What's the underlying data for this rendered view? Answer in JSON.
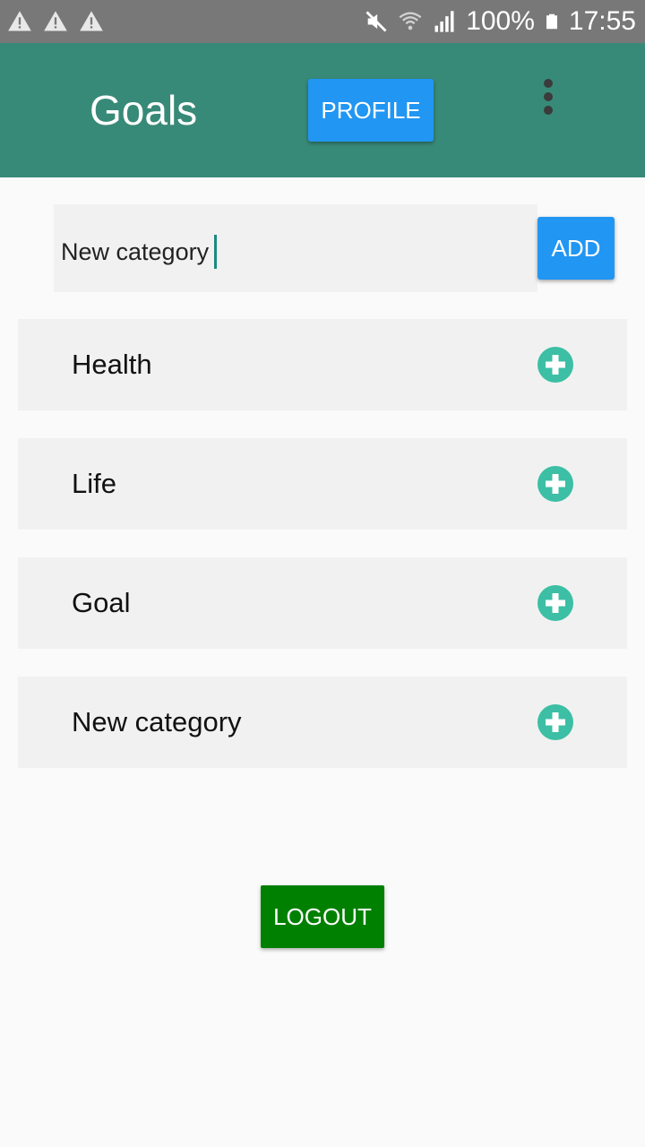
{
  "status_bar": {
    "battery": "100%",
    "time": "17:55",
    "left_icons": [
      "warning-icon",
      "warning-icon",
      "warning-icon"
    ],
    "right_icons": [
      "mute-icon",
      "wifi-icon",
      "signal-icon",
      "battery-icon"
    ]
  },
  "app_bar": {
    "title": "Goals",
    "profile_label": "PROFILE",
    "menu_icon": "more-vert-icon"
  },
  "new_category": {
    "value": "New category",
    "add_label": "ADD"
  },
  "categories": [
    {
      "label": "Health",
      "icon": "add-circle-icon"
    },
    {
      "label": "Life",
      "icon": "add-circle-icon"
    },
    {
      "label": "Goal",
      "icon": "add-circle-icon"
    },
    {
      "label": "New category",
      "icon": "add-circle-icon"
    }
  ],
  "logout_label": "LOGOUT",
  "colors": {
    "status_bar": "#787878",
    "app_bar": "#388a78",
    "primary_button": "#2196f3",
    "logout_button": "#008000",
    "plus_icon": "#3cbfa4",
    "card_background": "#f1f1f1"
  }
}
